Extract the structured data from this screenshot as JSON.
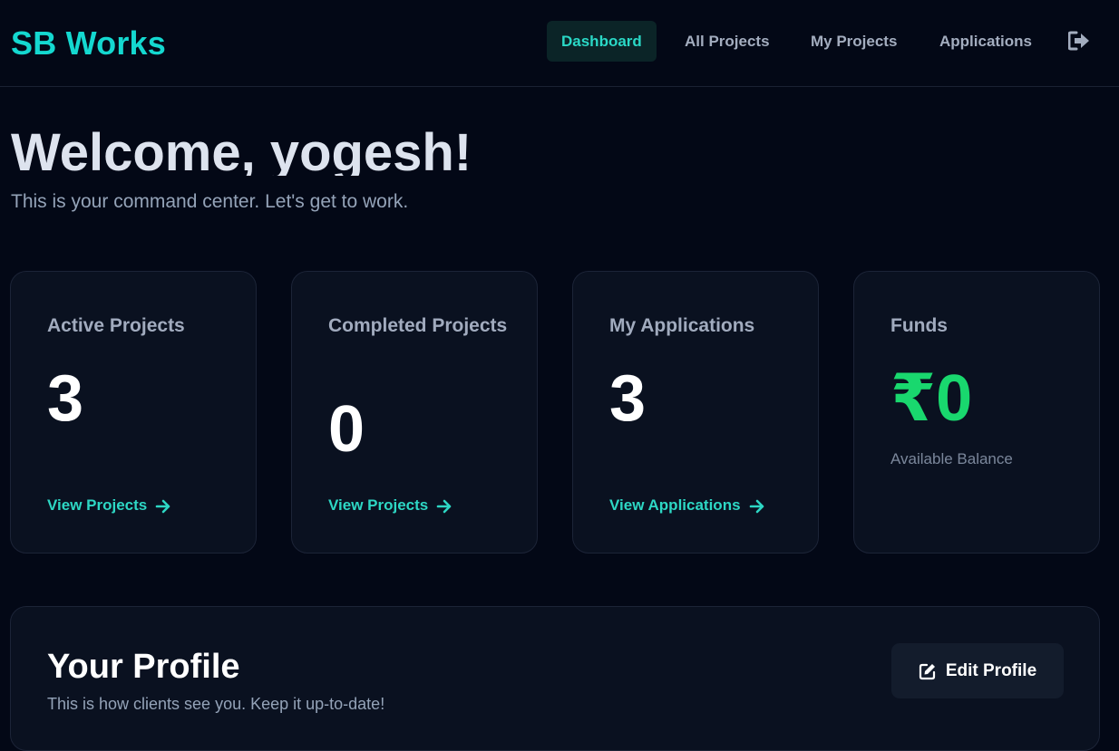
{
  "brand": "SB Works",
  "nav": {
    "items": [
      {
        "label": "Dashboard",
        "active": true
      },
      {
        "label": "All Projects",
        "active": false
      },
      {
        "label": "My Projects",
        "active": false
      },
      {
        "label": "Applications",
        "active": false
      }
    ],
    "logout_icon": "sign-out-icon"
  },
  "welcome": {
    "title": "Welcome, yogesh!",
    "subtitle": "This is your command center. Let's get to work."
  },
  "cards": [
    {
      "title": "Active Projects",
      "value": "3",
      "link": "View Projects"
    },
    {
      "title": "Completed Projects",
      "value": "0",
      "link": "View Projects"
    },
    {
      "title": "My Applications",
      "value": "3",
      "link": "View Applications"
    },
    {
      "title": "Funds",
      "value": "₹0",
      "caption": "Available Balance"
    }
  ],
  "profile": {
    "title": "Your Profile",
    "subtitle": "This is how clients see you. Keep it up-to-date!",
    "edit_label": "Edit Profile",
    "edit_icon": "edit-icon"
  },
  "colors": {
    "accent": "#14d8d0",
    "link": "#2dd7c4",
    "funds": "#19d86e",
    "background": "#030816",
    "card": "#0a1120"
  }
}
